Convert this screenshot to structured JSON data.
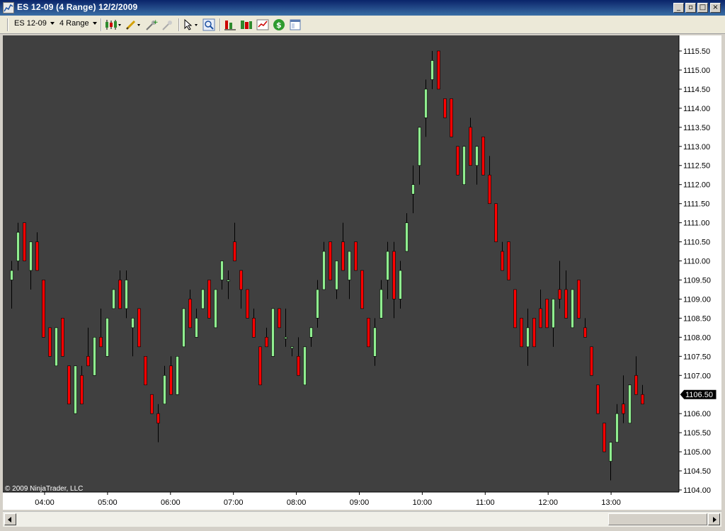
{
  "window": {
    "title": "ES 12-09 (4 Range)  12/2/2009"
  },
  "toolbar": {
    "instrument": "ES 12-09",
    "period": "4 Range",
    "icons": [
      "chart-style-icon",
      "draw-tool-icon",
      "add-indicator-icon",
      "remove-indicator-icon",
      "cursor-icon",
      "zoom-icon",
      "bar-spacing-icon",
      "bar-width-icon",
      "data-series-icon",
      "dollar-icon",
      "properties-icon"
    ]
  },
  "chart": {
    "copyright": "© 2009 NinjaTrader, LLC",
    "price_marker": "1106.50"
  },
  "colors": {
    "up": "#90ee90",
    "down": "#ff0000",
    "background": "#404040",
    "wick": "#000000"
  },
  "chart_data": {
    "type": "candlestick",
    "instrument": "ES 12-09",
    "bar_type": "4 Range",
    "date": "12/2/2009",
    "ylim": [
      1104.0,
      1115.75
    ],
    "y_ticks": [
      "1104.00",
      "1104.50",
      "1105.00",
      "1105.50",
      "1106.00",
      "1106.50",
      "1107.00",
      "1107.50",
      "1108.00",
      "1108.50",
      "1109.00",
      "1109.50",
      "1110.00",
      "1110.50",
      "1111.00",
      "1111.50",
      "1112.00",
      "1112.50",
      "1113.00",
      "1113.50",
      "1114.00",
      "1114.50",
      "1115.00",
      "1115.50"
    ],
    "x_ticks": [
      "04:00",
      "05:00",
      "06:00",
      "07:00",
      "08:00",
      "09:00",
      "10:00",
      "11:00",
      "12:00",
      "13:00"
    ],
    "last_price": "1106.50",
    "bars": [
      {
        "o": 1109.5,
        "h": 1110.0,
        "l": 1108.75,
        "c": 1109.75
      },
      {
        "o": 1110.0,
        "h": 1111.0,
        "l": 1109.75,
        "c": 1110.75
      },
      {
        "o": 1111.0,
        "h": 1111.0,
        "l": 1110.0,
        "c": 1110.0
      },
      {
        "o": 1109.75,
        "h": 1110.5,
        "l": 1109.25,
        "c": 1110.5
      },
      {
        "o": 1110.5,
        "h": 1110.75,
        "l": 1109.75,
        "c": 1109.75
      },
      {
        "o": 1109.5,
        "h": 1109.5,
        "l": 1108.0,
        "c": 1108.0
      },
      {
        "o": 1108.25,
        "h": 1108.25,
        "l": 1107.5,
        "c": 1107.5
      },
      {
        "o": 1107.25,
        "h": 1108.25,
        "l": 1107.25,
        "c": 1108.25
      },
      {
        "o": 1108.5,
        "h": 1108.5,
        "l": 1107.5,
        "c": 1107.5
      },
      {
        "o": 1107.25,
        "h": 1107.25,
        "l": 1106.25,
        "c": 1106.25
      },
      {
        "o": 1106.0,
        "h": 1107.25,
        "l": 1106.0,
        "c": 1107.25
      },
      {
        "o": 1107.0,
        "h": 1107.25,
        "l": 1106.25,
        "c": 1106.25
      },
      {
        "o": 1107.5,
        "h": 1108.25,
        "l": 1107.25,
        "c": 1107.25
      },
      {
        "o": 1107.0,
        "h": 1108.0,
        "l": 1107.0,
        "c": 1108.0
      },
      {
        "o": 1108.0,
        "h": 1108.75,
        "l": 1107.75,
        "c": 1107.75
      },
      {
        "o": 1107.5,
        "h": 1108.5,
        "l": 1107.5,
        "c": 1108.5
      },
      {
        "o": 1108.75,
        "h": 1109.25,
        "l": 1108.75,
        "c": 1109.25
      },
      {
        "o": 1109.5,
        "h": 1109.75,
        "l": 1108.75,
        "c": 1108.75
      },
      {
        "o": 1108.75,
        "h": 1109.75,
        "l": 1108.5,
        "c": 1109.5
      },
      {
        "o": 1108.25,
        "h": 1108.5,
        "l": 1107.5,
        "c": 1108.5
      },
      {
        "o": 1108.75,
        "h": 1108.75,
        "l": 1107.75,
        "c": 1107.75
      },
      {
        "o": 1107.5,
        "h": 1107.5,
        "l": 1106.75,
        "c": 1106.75
      },
      {
        "o": 1106.5,
        "h": 1106.5,
        "l": 1106.0,
        "c": 1106.0
      },
      {
        "o": 1106.0,
        "h": 1106.25,
        "l": 1105.25,
        "c": 1105.75
      },
      {
        "o": 1106.25,
        "h": 1107.25,
        "l": 1106.25,
        "c": 1107.0
      },
      {
        "o": 1107.25,
        "h": 1107.5,
        "l": 1106.5,
        "c": 1106.5
      },
      {
        "o": 1106.5,
        "h": 1107.5,
        "l": 1106.5,
        "c": 1107.5
      },
      {
        "o": 1107.75,
        "h": 1108.75,
        "l": 1107.75,
        "c": 1108.75
      },
      {
        "o": 1109.0,
        "h": 1109.25,
        "l": 1108.25,
        "c": 1108.25
      },
      {
        "o": 1108.0,
        "h": 1108.75,
        "l": 1108.0,
        "c": 1108.5
      },
      {
        "o": 1108.75,
        "h": 1109.25,
        "l": 1108.75,
        "c": 1109.25
      },
      {
        "o": 1109.5,
        "h": 1109.5,
        "l": 1108.5,
        "c": 1108.5
      },
      {
        "o": 1108.25,
        "h": 1109.25,
        "l": 1108.25,
        "c": 1109.25
      },
      {
        "o": 1109.5,
        "h": 1110.0,
        "l": 1109.25,
        "c": 1110.0
      },
      {
        "o": 1109.5,
        "h": 1109.75,
        "l": 1109.0,
        "c": 1109.5
      },
      {
        "o": 1110.5,
        "h": 1111.0,
        "l": 1110.0,
        "c": 1110.0
      },
      {
        "o": 1109.75,
        "h": 1109.75,
        "l": 1108.75,
        "c": 1109.25
      },
      {
        "o": 1109.25,
        "h": 1109.25,
        "l": 1108.5,
        "c": 1108.5
      },
      {
        "o": 1108.5,
        "h": 1108.75,
        "l": 1108.0,
        "c": 1108.0
      },
      {
        "o": 1107.75,
        "h": 1107.75,
        "l": 1106.75,
        "c": 1106.75
      },
      {
        "o": 1108.0,
        "h": 1108.25,
        "l": 1107.75,
        "c": 1107.75
      },
      {
        "o": 1107.5,
        "h": 1108.75,
        "l": 1107.5,
        "c": 1108.75
      },
      {
        "o": 1108.75,
        "h": 1108.75,
        "l": 1108.25,
        "c": 1108.25
      },
      {
        "o": 1108.0,
        "h": 1108.75,
        "l": 1107.75,
        "c": 1108.0
      },
      {
        "o": 1107.75,
        "h": 1107.75,
        "l": 1107.5,
        "c": 1107.75
      },
      {
        "o": 1107.5,
        "h": 1108.0,
        "l": 1107.0,
        "c": 1107.0
      },
      {
        "o": 1106.75,
        "h": 1107.75,
        "l": 1106.75,
        "c": 1107.75
      },
      {
        "o": 1108.0,
        "h": 1108.25,
        "l": 1107.75,
        "c": 1108.25
      },
      {
        "o": 1108.5,
        "h": 1109.5,
        "l": 1108.25,
        "c": 1109.25
      },
      {
        "o": 1109.25,
        "h": 1110.5,
        "l": 1109.25,
        "c": 1110.25
      },
      {
        "o": 1110.5,
        "h": 1110.5,
        "l": 1109.5,
        "c": 1109.5
      },
      {
        "o": 1109.25,
        "h": 1110.0,
        "l": 1109.0,
        "c": 1110.0
      },
      {
        "o": 1110.5,
        "h": 1111.0,
        "l": 1109.75,
        "c": 1109.75
      },
      {
        "o": 1109.5,
        "h": 1110.25,
        "l": 1109.0,
        "c": 1110.25
      },
      {
        "o": 1110.5,
        "h": 1110.5,
        "l": 1109.75,
        "c": 1109.75
      },
      {
        "o": 1109.75,
        "h": 1109.75,
        "l": 1108.75,
        "c": 1108.75
      },
      {
        "o": 1108.5,
        "h": 1108.5,
        "l": 1107.75,
        "c": 1107.75
      },
      {
        "o": 1107.5,
        "h": 1108.5,
        "l": 1107.25,
        "c": 1108.25
      },
      {
        "o": 1108.5,
        "h": 1109.5,
        "l": 1108.5,
        "c": 1109.25
      },
      {
        "o": 1109.5,
        "h": 1110.5,
        "l": 1109.0,
        "c": 1110.25
      },
      {
        "o": 1110.25,
        "h": 1110.5,
        "l": 1108.5,
        "c": 1109.0
      },
      {
        "o": 1109.0,
        "h": 1110.0,
        "l": 1108.75,
        "c": 1109.75
      },
      {
        "o": 1110.25,
        "h": 1111.25,
        "l": 1110.25,
        "c": 1111.0
      },
      {
        "o": 1111.75,
        "h": 1112.5,
        "l": 1111.25,
        "c": 1112.0
      },
      {
        "o": 1112.5,
        "h": 1113.0,
        "l": 1112.0,
        "c": 1113.5
      },
      {
        "o": 1113.75,
        "h": 1114.75,
        "l": 1113.25,
        "c": 1114.5
      },
      {
        "o": 1114.75,
        "h": 1115.5,
        "l": 1114.5,
        "c": 1115.25
      },
      {
        "o": 1115.5,
        "h": 1115.5,
        "l": 1114.5,
        "c": 1114.5
      },
      {
        "o": 1114.25,
        "h": 1114.25,
        "l": 1113.75,
        "c": 1113.75
      },
      {
        "o": 1114.25,
        "h": 1114.25,
        "l": 1113.25,
        "c": 1113.25
      },
      {
        "o": 1113.0,
        "h": 1113.0,
        "l": 1112.25,
        "c": 1112.25
      },
      {
        "o": 1112.0,
        "h": 1113.0,
        "l": 1112.0,
        "c": 1113.0
      },
      {
        "o": 1113.5,
        "h": 1113.75,
        "l": 1112.5,
        "c": 1112.5
      },
      {
        "o": 1112.5,
        "h": 1113.0,
        "l": 1112.0,
        "c": 1113.0
      },
      {
        "o": 1113.25,
        "h": 1113.25,
        "l": 1112.25,
        "c": 1112.25
      },
      {
        "o": 1112.25,
        "h": 1112.75,
        "l": 1111.5,
        "c": 1111.5
      },
      {
        "o": 1111.5,
        "h": 1111.5,
        "l": 1110.5,
        "c": 1110.5
      },
      {
        "o": 1110.25,
        "h": 1110.5,
        "l": 1109.75,
        "c": 1109.75
      },
      {
        "o": 1110.5,
        "h": 1110.5,
        "l": 1109.5,
        "c": 1109.5
      },
      {
        "o": 1109.25,
        "h": 1109.25,
        "l": 1108.25,
        "c": 1108.25
      },
      {
        "o": 1108.5,
        "h": 1108.5,
        "l": 1107.75,
        "c": 1107.75
      },
      {
        "o": 1107.75,
        "h": 1108.75,
        "l": 1107.25,
        "c": 1108.25
      },
      {
        "o": 1108.5,
        "h": 1108.5,
        "l": 1107.75,
        "c": 1107.75
      },
      {
        "o": 1108.75,
        "h": 1109.25,
        "l": 1108.25,
        "c": 1108.25
      },
      {
        "o": 1109.0,
        "h": 1109.0,
        "l": 1108.25,
        "c": 1108.25
      },
      {
        "o": 1108.25,
        "h": 1109.0,
        "l": 1107.75,
        "c": 1109.0
      },
      {
        "o": 1109.25,
        "h": 1110.0,
        "l": 1108.75,
        "c": 1109.0
      },
      {
        "o": 1109.25,
        "h": 1109.75,
        "l": 1108.5,
        "c": 1108.5
      },
      {
        "o": 1108.25,
        "h": 1109.25,
        "l": 1108.25,
        "c": 1109.25
      },
      {
        "o": 1109.5,
        "h": 1109.5,
        "l": 1108.5,
        "c": 1108.5
      },
      {
        "o": 1108.25,
        "h": 1108.5,
        "l": 1108.0,
        "c": 1108.0
      },
      {
        "o": 1107.75,
        "h": 1107.75,
        "l": 1107.0,
        "c": 1107.0
      },
      {
        "o": 1106.75,
        "h": 1106.75,
        "l": 1106.0,
        "c": 1106.0
      },
      {
        "o": 1105.75,
        "h": 1105.75,
        "l": 1105.0,
        "c": 1105.0
      },
      {
        "o": 1104.75,
        "h": 1105.25,
        "l": 1104.25,
        "c": 1105.25
      },
      {
        "o": 1105.25,
        "h": 1106.25,
        "l": 1105.25,
        "c": 1106.0
      },
      {
        "o": 1106.25,
        "h": 1107.0,
        "l": 1105.75,
        "c": 1106.0
      },
      {
        "o": 1105.75,
        "h": 1106.75,
        "l": 1105.75,
        "c": 1106.75
      },
      {
        "o": 1107.0,
        "h": 1107.5,
        "l": 1106.5,
        "c": 1106.5
      },
      {
        "o": 1106.5,
        "h": 1106.75,
        "l": 1106.25,
        "c": 1106.25
      }
    ]
  }
}
